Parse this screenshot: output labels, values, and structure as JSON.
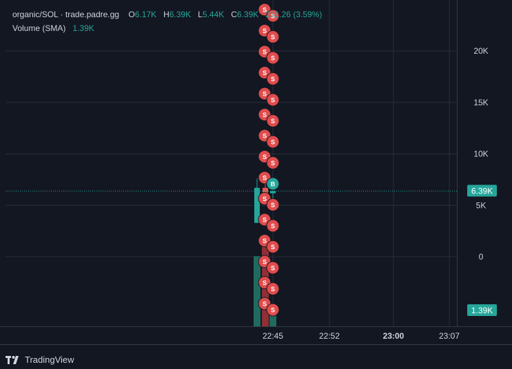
{
  "legend": {
    "symbol": "organic/SOL · trade.padre.gg",
    "open_label": "O",
    "open": "6.17K",
    "high_label": "H",
    "high": "6.39K",
    "low_label": "L",
    "low": "5.44K",
    "close_label": "C",
    "close": "6.39K",
    "change": "221.26",
    "change_pct": "(3.59%)",
    "volume_label": "Volume (SMA)",
    "volume": "1.39K"
  },
  "branding": {
    "name": "TradingView"
  },
  "colors": {
    "background": "#131722",
    "up": "#26a69a",
    "down": "#ef5350",
    "marker_sell": "#e04c4c",
    "marker_buy": "#26a69a",
    "grid": "#2a2e39",
    "text": "#d1d4dc"
  },
  "chart_data": {
    "type": "candlestick",
    "y_ticks": [
      {
        "value": 20000,
        "label": "20K"
      },
      {
        "value": 15000,
        "label": "15K"
      },
      {
        "value": 10000,
        "label": "10K"
      },
      {
        "value": 5000,
        "label": "5K"
      },
      {
        "value": 0,
        "label": "0"
      }
    ],
    "x_ticks": [
      {
        "label": "22:45",
        "bold": false
      },
      {
        "label": "22:52",
        "bold": false
      },
      {
        "label": "23:00",
        "bold": true
      },
      {
        "label": "23:07",
        "bold": false
      }
    ],
    "candles": [
      {
        "time": "22:44",
        "open": 3300,
        "high": 7600,
        "low": 3300,
        "close": 6700,
        "dir": "up"
      },
      {
        "time": "22:45",
        "open": 6700,
        "high": 7100,
        "low": 5000,
        "close": 6200,
        "dir": "down"
      },
      {
        "time": "22:46",
        "open": 6170,
        "high": 6390,
        "low": 5440,
        "close": 6390,
        "dir": "up"
      }
    ],
    "volume": [
      {
        "time": "22:44",
        "dir": "up",
        "relative": 0.67
      },
      {
        "time": "22:45",
        "dir": "down",
        "relative": 0.77
      },
      {
        "time": "22:46",
        "dir": "up",
        "relative": 0.16
      }
    ],
    "last_price": {
      "value": 6390,
      "label": "6.39K"
    },
    "last_volume": {
      "label": "1.39K"
    },
    "markers": [
      {
        "text": "S",
        "type": "sell"
      },
      {
        "text": "S",
        "type": "sell"
      },
      {
        "text": "S",
        "type": "sell"
      },
      {
        "text": "S",
        "type": "sell"
      },
      {
        "text": "S",
        "type": "sell"
      },
      {
        "text": "S",
        "type": "sell"
      },
      {
        "text": "S",
        "type": "sell"
      },
      {
        "text": "S",
        "type": "sell"
      },
      {
        "text": "S",
        "type": "sell"
      },
      {
        "text": "S",
        "type": "sell"
      },
      {
        "text": "S",
        "type": "sell"
      },
      {
        "text": "S",
        "type": "sell"
      },
      {
        "text": "S",
        "type": "sell"
      },
      {
        "text": "S",
        "type": "sell"
      },
      {
        "text": "S",
        "type": "sell"
      },
      {
        "text": "S",
        "type": "sell"
      },
      {
        "text": "S",
        "type": "sell"
      },
      {
        "text": "B",
        "type": "buy"
      },
      {
        "text": "S",
        "type": "sell"
      },
      {
        "text": "S",
        "type": "sell"
      },
      {
        "text": "S",
        "type": "sell"
      },
      {
        "text": "S",
        "type": "sell"
      },
      {
        "text": "S",
        "type": "sell"
      },
      {
        "text": "S",
        "type": "sell"
      },
      {
        "text": "S",
        "type": "sell"
      },
      {
        "text": "S",
        "type": "sell"
      },
      {
        "text": "S",
        "type": "sell"
      },
      {
        "text": "S",
        "type": "sell"
      },
      {
        "text": "S",
        "type": "sell"
      },
      {
        "text": "S",
        "type": "sell"
      }
    ]
  }
}
